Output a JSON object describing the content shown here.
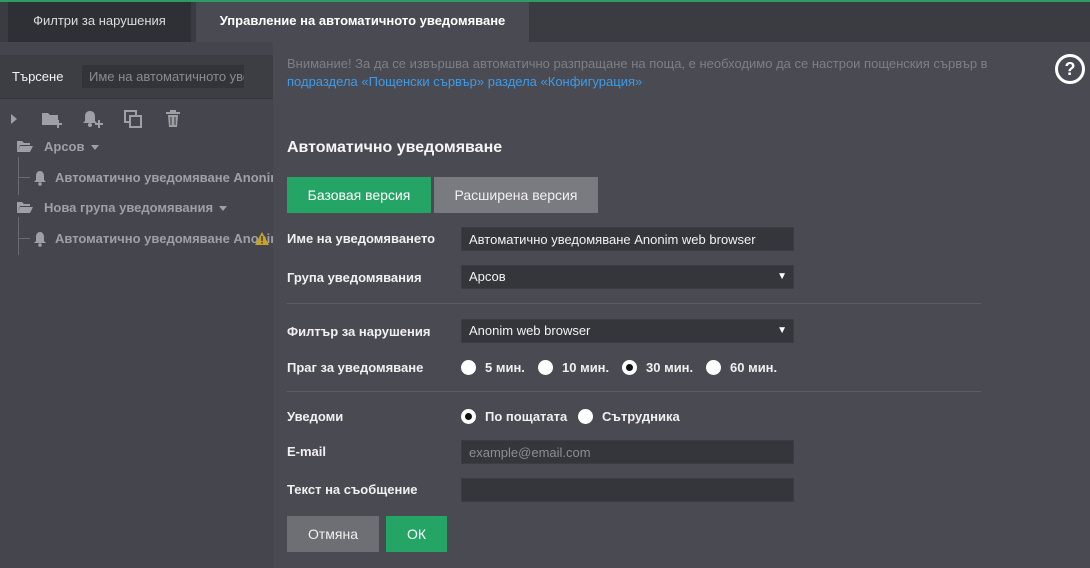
{
  "tabs": [
    {
      "label": "Филтри за нарушения"
    },
    {
      "label": "Управление на автоматичното уведомяване"
    }
  ],
  "sidebar": {
    "search_label": "Търсене",
    "search_placeholder": "Име на автоматичното уведомяване",
    "toolbar_icons": [
      "expand-icon",
      "add-folder-icon",
      "add-notification-icon",
      "copy-icon",
      "delete-icon"
    ],
    "tree": [
      {
        "type": "group",
        "label": "Арсов"
      },
      {
        "type": "item",
        "label": "Автоматично уведомяване Anonim web browser"
      },
      {
        "type": "group",
        "label": "Нова група уведомявания"
      },
      {
        "type": "item",
        "label": "Автоматично уведомяване Anonim web browser",
        "warning": true
      }
    ]
  },
  "main": {
    "warning_text": "Внимание! За да се извършва автоматично разпращане на поща, е необходимо да се настрои пощенския сървър в ",
    "warning_link": "подраздела «Пощенски сървър» раздела «Конфигурация»",
    "help_label": "?",
    "section_title": "Автоматично уведомяване",
    "version_tabs": {
      "basic": "Базовая версия",
      "extended": "Расширена версия"
    },
    "form": {
      "name_label": "Име на уведомяването",
      "name_value": "Автоматично уведомяване Anonim web browser",
      "group_label": "Група уведомявания",
      "group_value": "Арсов",
      "filter_label": "Филтър за нарушения",
      "filter_value": "Anonim web browser",
      "threshold_label": "Праг за уведомяване",
      "threshold_options": [
        "5 мин.",
        "10 мин.",
        "30 мин.",
        "60 мин."
      ],
      "threshold_selected": "30 мин.",
      "notify_label": "Уведоми",
      "notify_options": [
        "По пощатата",
        "Сътрудника"
      ],
      "notify_selected": "По пощатата",
      "email_label": "E-mail",
      "email_placeholder": "example@email.com",
      "email_value": "",
      "message_label": "Текст на съобщение",
      "message_value": ""
    },
    "buttons": {
      "cancel": "Отмяна",
      "ok": "ОК"
    }
  },
  "colors": {
    "accent": "#24a566",
    "link": "#3d9be9",
    "background": "#4a4b52",
    "warning_icon": "#c9a227"
  }
}
